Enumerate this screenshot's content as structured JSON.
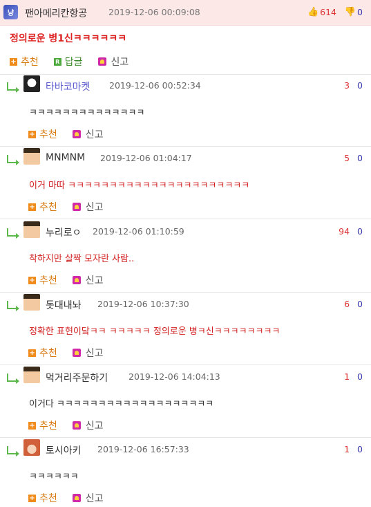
{
  "post": {
    "avatar_text": "냥",
    "username": "팬아메리칸항공",
    "date": "2019-12-06 00:09:08",
    "upvotes": "614",
    "downvotes": "0",
    "title": "정의로운 병1신ㅋㅋㅋㅋㅋㅋ",
    "recommend_label": "추천",
    "reply_label": "답글",
    "reply_icon_letter": "R",
    "report_label": "신고"
  },
  "comments": [
    {
      "username": "타바코마켓",
      "date": "2019-12-06 00:52:34",
      "up": "3",
      "down": "0",
      "text": "ㅋㅋㅋㅋㅋㅋㅋㅋㅋㅋㅋㅋㅋㅋ",
      "text_color": "#333333",
      "name_color": "#5a5ad0",
      "recommend_label": "추천",
      "report_label": "신고"
    },
    {
      "username": "MNMNM",
      "date": "2019-12-06 01:04:17",
      "up": "5",
      "down": "0",
      "text": "이거 마따 ㅋㅋㅋㅋㅋㅋㅋㅋㅋㅋㅋㅋㅋㅋㅋㅋㅋㅋㅋㅋㅋㅋ",
      "text_color": "#d22222",
      "name_color": "#333333",
      "recommend_label": "추천",
      "report_label": "신고"
    },
    {
      "username": "누리로ㅇ",
      "date": "2019-12-06 01:10:59",
      "up": "94",
      "down": "0",
      "text": "착하지만 살짝 모자란 사람..",
      "text_color": "#d22222",
      "name_color": "#333333",
      "recommend_label": "추천",
      "report_label": "신고"
    },
    {
      "username": "돗대내놔",
      "date": "2019-12-06 10:37:30",
      "up": "6",
      "down": "0",
      "text": "정확한 표현이닼ㅋㅋ ㅋㅋㅋㅋㅋ 정의로운 병ㅋ신ㅋㅋㅋㅋㅋㅋㅋㅋ",
      "text_color": "#d22222",
      "name_color": "#333333",
      "recommend_label": "추천",
      "report_label": "신고"
    },
    {
      "username": "먹거리주문하기",
      "date": "2019-12-06 14:04:13",
      "up": "1",
      "down": "0",
      "text": "이거다 ㅋㅋㅋㅋㅋㅋㅋㅋㅋㅋㅋㅋㅋㅋㅋㅋㅋㅋㅋ",
      "text_color": "#333333",
      "name_color": "#333333",
      "recommend_label": "추천",
      "report_label": "신고"
    },
    {
      "username": "토시아키",
      "date": "2019-12-06 16:57:33",
      "up": "1",
      "down": "0",
      "text": "ㅋㅋㅋㅋㅋㅋ",
      "text_color": "#333333",
      "name_color": "#333333",
      "recommend_label": "추천",
      "report_label": "신고"
    }
  ],
  "colors": {
    "header_bg": "#fde8e8",
    "upvote": "#dd3333",
    "downvote": "#3a3ab0",
    "accent_orange": "#f08c1c",
    "reply_green": "#5cb84a"
  }
}
